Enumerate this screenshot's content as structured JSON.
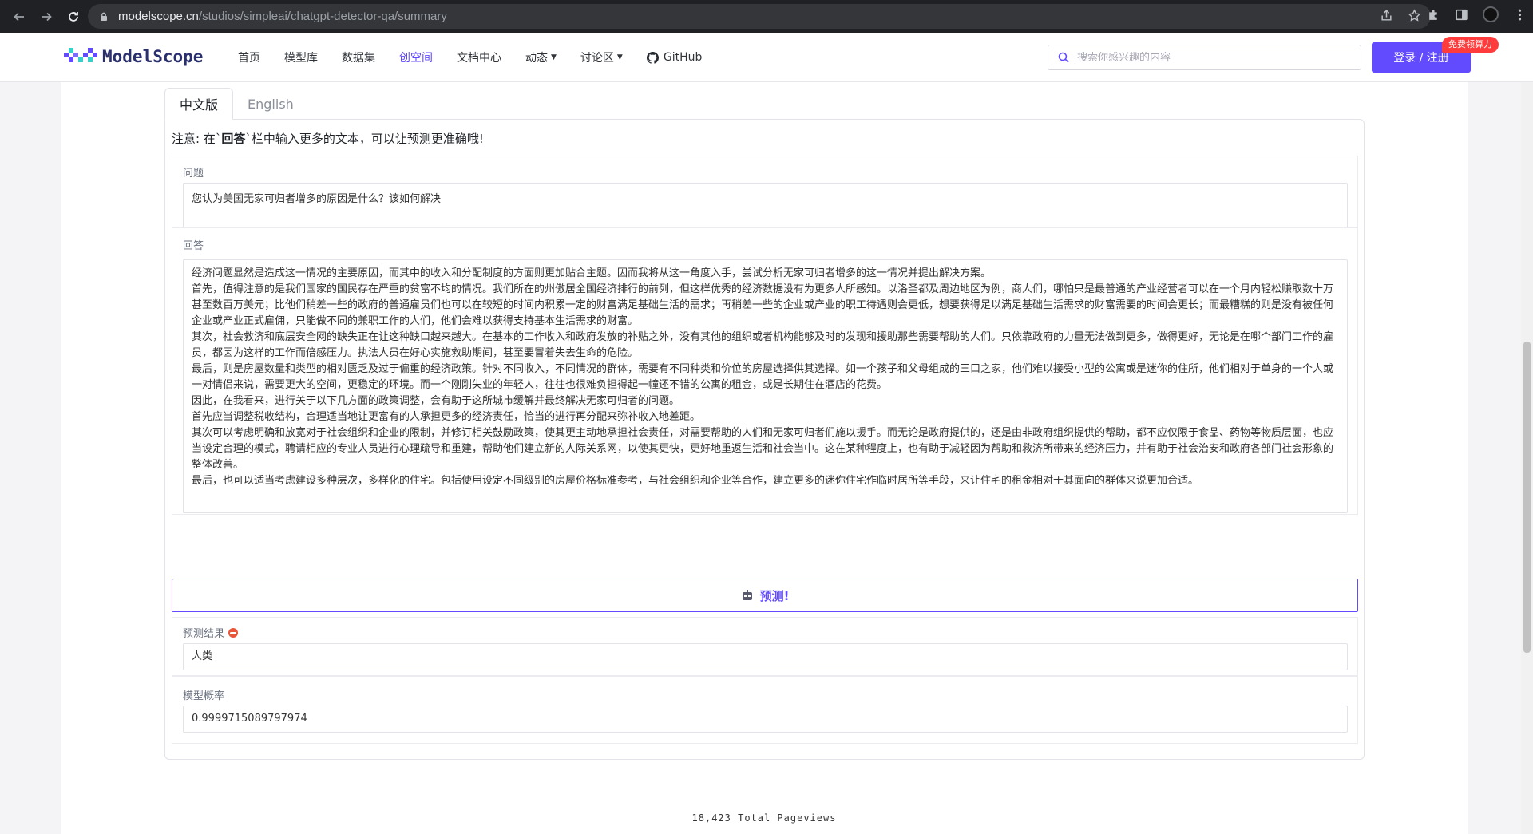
{
  "browser": {
    "url_domain": "modelscope.cn",
    "url_path": "/studios/simpleai/chatgpt-detector-qa/summary"
  },
  "header": {
    "logo_text": "ModelScope",
    "nav": [
      {
        "label": "首页"
      },
      {
        "label": "模型库"
      },
      {
        "label": "数据集"
      },
      {
        "label": "创空间",
        "active": true
      },
      {
        "label": "文档中心"
      },
      {
        "label": "动态"
      },
      {
        "label": "讨论区"
      },
      {
        "label": "GitHub"
      }
    ],
    "search_placeholder": "搜索你感兴趣的内容",
    "login_label": "登录 / 注册",
    "promo_badge": "免费领算力"
  },
  "tabs": [
    {
      "label": "中文版",
      "active": true
    },
    {
      "label": "English",
      "active": false
    }
  ],
  "notice": {
    "prefix": "注意: 在`",
    "bold": "回答",
    "suffix": "`栏中输入更多的文本，可以让预测更准确哦!"
  },
  "question": {
    "label": "问题",
    "value": "您认为美国无家可归者增多的原因是什么？该如何解决"
  },
  "answer": {
    "label": "回答",
    "paragraphs": [
      "经济问题显然是造成这一情况的主要原因，而其中的收入和分配制度的方面则更加贴合主题。因而我将从这一角度入手，尝试分析无家可归者增多的这一情况并提出解决方案。",
      "首先，值得注意的是我们国家的国民存在严重的贫富不均的情况。我们所在的州傲居全国经济排行的前列，但这样优秀的经济数据没有为更多人所感知。以洛圣都及周边地区为例，商人们，哪怕只是最普通的产业经营者可以在一个月内轻松赚取数十万甚至数百万美元；比他们稍差一些的政府的普通雇员们也可以在较短的时间内积累一定的财富满足基础生活的需求；再稍差一些的企业或产业的职工待遇则会更低，想要获得足以满足基础生活需求的财富需要的时间会更长；而最糟糕的则是没有被任何企业或产业正式雇佣，只能做不同的兼职工作的人们，他们会难以获得支持基本生活需求的财富。",
      "其次，社会救济和底层安全网的缺失正在让这种缺口越来越大。在基本的工作收入和政府发放的补贴之外，没有其他的组织或者机构能够及时的发现和援助那些需要帮助的人们。只依靠政府的力量无法做到更多，做得更好，无论是在哪个部门工作的雇员，都因为这样的工作而倍感压力。执法人员在好心实施救助期间，甚至要冒着失去生命的危险。",
      "最后，则是房屋数量和类型的相对匮乏及过于偏重的经济政策。针对不同收入，不同情况的群体，需要有不同种类和价位的房屋选择供其选择。如一个孩子和父母组成的三口之家，他们难以接受小型的公寓或是迷你的住所，他们相对于单身的一个人或一对情侣来说，需要更大的空间，更稳定的环境。而一个刚刚失业的年轻人，往往也很难负担得起一幢还不错的公寓的租金，或是长期住在酒店的花费。",
      "因此，在我看来，进行关于以下几方面的政策调整，会有助于这所城市缓解并最终解决无家可归者的问题。",
      "首先应当调整税收结构，合理适当地让更富有的人承担更多的经济责任，恰当的进行再分配来弥补收入地差距。",
      "其次可以考虑明确和放宽对于社会组织和企业的限制，并修订相关鼓励政策，使其更主动地承担社会责任，对需要帮助的人们和无家可归者们施以援手。而无论是政府提供的，还是由非政府组织提供的帮助，都不应仅限于食品、药物等物质层面，也应当设定合理的模式，聘请相应的专业人员进行心理疏导和重建，帮助他们建立新的人际关系网，以使其更快，更好地重返生活和社会当中。这在某种程度上，也有助于减轻因为帮助和救济所带来的经济压力，并有助于社会治安和政府各部门社会形象的整体改善。",
      "最后，也可以适当考虑建设多种层次，多样化的住宅。包括使用设定不同级别的房屋价格标准参考，与社会组织和企业等合作，建立更多的迷你住宅作临时居所等手段，来让住宅的租金相对于其面向的群体来说更加合适。"
    ]
  },
  "predict_button": {
    "label": "预测!"
  },
  "result": {
    "label": "预测结果",
    "value": "人类"
  },
  "probability": {
    "label": "模型概率",
    "value": "0.9999715089797974"
  },
  "footer": {
    "pageviews": "18,423 Total Pageviews"
  }
}
